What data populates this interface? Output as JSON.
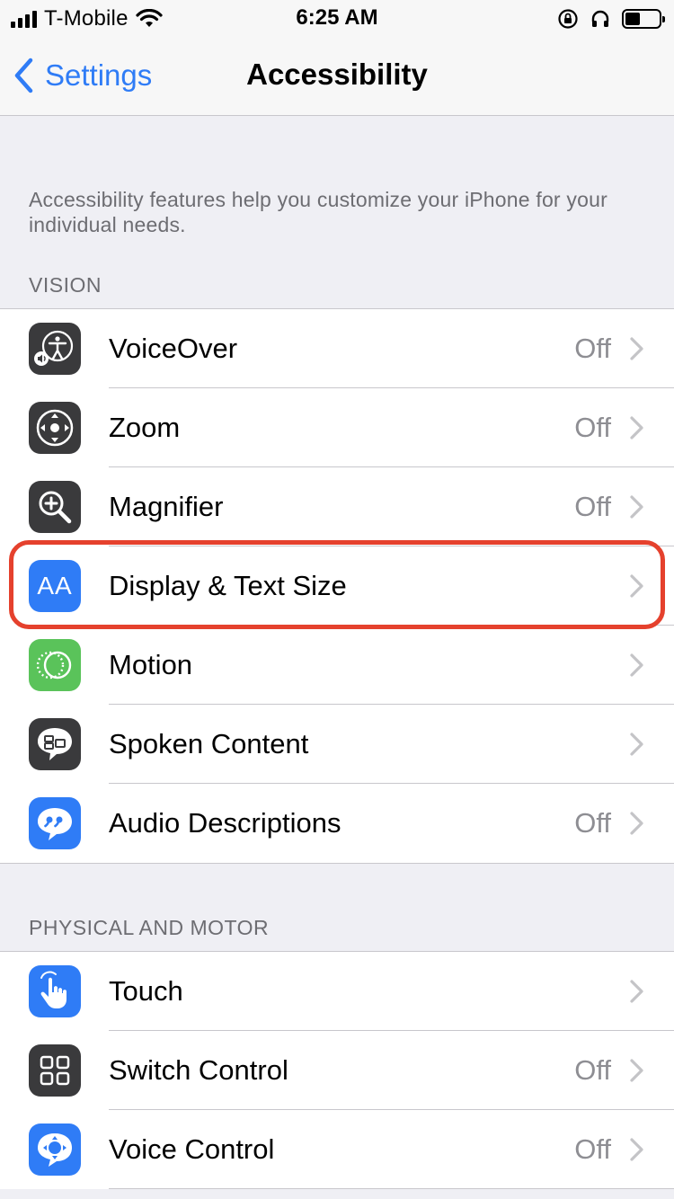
{
  "status_bar": {
    "carrier": "T-Mobile",
    "time": "6:25 AM",
    "icons": [
      "signal-icon",
      "wifi-icon",
      "rotation-lock-icon",
      "headphones-icon",
      "battery-icon"
    ]
  },
  "nav": {
    "back_label": "Settings",
    "title": "Accessibility"
  },
  "intro_text": "Accessibility features help you customize your iPhone for your individual needs.",
  "sections": [
    {
      "header": "VISION",
      "rows": [
        {
          "label": "VoiceOver",
          "value": "Off",
          "icon": "voiceover-icon"
        },
        {
          "label": "Zoom",
          "value": "Off",
          "icon": "zoom-icon"
        },
        {
          "label": "Magnifier",
          "value": "Off",
          "icon": "magnifier-icon"
        },
        {
          "label": "Display & Text Size",
          "value": "",
          "icon": "text-size-icon",
          "icon_text": "AA"
        },
        {
          "label": "Motion",
          "value": "",
          "icon": "motion-icon"
        },
        {
          "label": "Spoken Content",
          "value": "",
          "icon": "spoken-content-icon"
        },
        {
          "label": "Audio Descriptions",
          "value": "Off",
          "icon": "audio-descriptions-icon"
        }
      ]
    },
    {
      "header": "PHYSICAL AND MOTOR",
      "rows": [
        {
          "label": "Touch",
          "value": "",
          "icon": "touch-icon"
        },
        {
          "label": "Switch Control",
          "value": "Off",
          "icon": "switch-control-icon"
        },
        {
          "label": "Voice Control",
          "value": "Off",
          "icon": "voice-control-icon"
        }
      ]
    }
  ],
  "colors": {
    "accent": "#2f7cf6",
    "highlight": "#e5412d",
    "icon_gray": "#3a3a3c",
    "icon_green": "#5ac35a",
    "secondary_text": "#8e8e93"
  }
}
